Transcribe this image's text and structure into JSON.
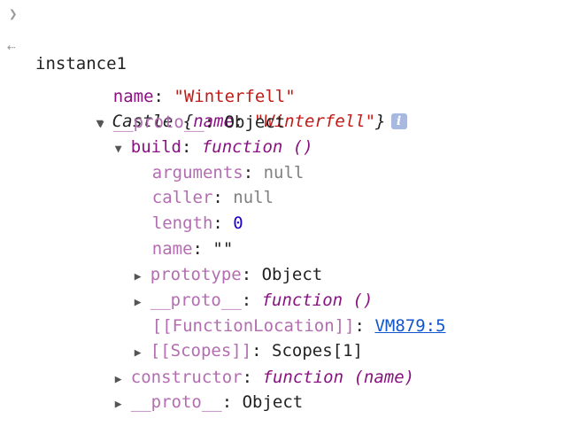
{
  "input": {
    "prompt_icon": "chevron-right-icon",
    "command": "instance1"
  },
  "result": {
    "return_icon": "return-arrow-icon",
    "class_name": "Castle",
    "open_brace": "{",
    "preview_key": "name",
    "preview_value": "\"Winterfell\"",
    "close_brace": "}",
    "info_icon": "info-icon",
    "info_letter": "i"
  },
  "lines": {
    "name_key": "name",
    "name_value": "\"Winterfell\"",
    "proto_key": "__proto__",
    "proto_value": "Object",
    "build_key": "build",
    "build_value": "function ()",
    "arguments_key": "arguments",
    "arguments_value": "null",
    "caller_key": "caller",
    "caller_value": "null",
    "length_key": "length",
    "length_value": "0",
    "fname_key": "name",
    "fname_value": "\"\"",
    "prototype_key": "prototype",
    "prototype_value": "Object",
    "fproto_key": "__proto__",
    "fproto_value": "function ()",
    "location_key": "[[FunctionLocation]]",
    "location_value": "VM879:5",
    "scopes_key": "[[Scopes]]",
    "scopes_value": "Scopes[1]",
    "constructor_key": "constructor",
    "constructor_value": "function (name)",
    "oproto_key": "__proto__",
    "oproto_value": "Object"
  },
  "colors": {
    "own_key": "#881280",
    "inherited_key": "#b36db0",
    "string": "#c41a16",
    "number": "#1c00cf",
    "null": "#808080",
    "link": "#1155cc"
  }
}
